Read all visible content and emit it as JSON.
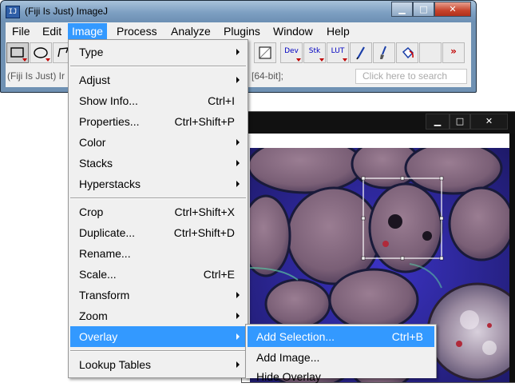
{
  "window": {
    "title": "(Fiji Is Just) ImageJ",
    "icon": "imagej-app-icon",
    "controls": {
      "minimize": "▁",
      "maximize": "□",
      "close": "✕"
    }
  },
  "menubar": {
    "items": [
      {
        "label": "File"
      },
      {
        "label": "Edit"
      },
      {
        "label": "Image",
        "active": true
      },
      {
        "label": "Process"
      },
      {
        "label": "Analyze"
      },
      {
        "label": "Plugins"
      },
      {
        "label": "Window"
      },
      {
        "label": "Help"
      }
    ]
  },
  "toolbar": {
    "dev": "Dev",
    "stk": "Stk",
    "lut": "LUT",
    "more": "»"
  },
  "statusbar": {
    "left_text": "(Fiji Is Just) Ir",
    "right_text": "[64-bit];",
    "search_placeholder": "Click here to search"
  },
  "image_window": {
    "controls": {
      "minimize": "▁",
      "maximize": "□",
      "close": "✕"
    }
  },
  "image_menu": {
    "items": [
      {
        "label": "Type",
        "submenu": true
      },
      {
        "label": "Adjust",
        "submenu": true
      },
      {
        "label": "Show Info...",
        "shortcut": "Ctrl+I"
      },
      {
        "label": "Properties...",
        "shortcut": "Ctrl+Shift+P"
      },
      {
        "label": "Color",
        "submenu": true
      },
      {
        "label": "Stacks",
        "submenu": true
      },
      {
        "label": "Hyperstacks",
        "submenu": true
      },
      {
        "label": "Crop",
        "shortcut": "Ctrl+Shift+X"
      },
      {
        "label": "Duplicate...",
        "shortcut": "Ctrl+Shift+D"
      },
      {
        "label": "Rename..."
      },
      {
        "label": "Scale...",
        "shortcut": "Ctrl+E"
      },
      {
        "label": "Transform",
        "submenu": true
      },
      {
        "label": "Zoom",
        "submenu": true
      },
      {
        "label": "Overlay",
        "submenu": true,
        "highlighted": true
      },
      {
        "label": "Lookup Tables",
        "submenu": true
      }
    ]
  },
  "overlay_menu": {
    "items": [
      {
        "label": "Add Selection...",
        "shortcut": "Ctrl+B",
        "highlighted": true
      },
      {
        "label": "Add Image..."
      },
      {
        "label": "Hide Overlay"
      }
    ]
  },
  "colors": {
    "highlight": "#3399ff",
    "menu_bg": "#f0f0f0",
    "titlebar": "#7d9fc2",
    "close_button": "#c7432b",
    "tissue_blue": "#2f2bb0",
    "tissue_pink": "#8a6f84"
  }
}
